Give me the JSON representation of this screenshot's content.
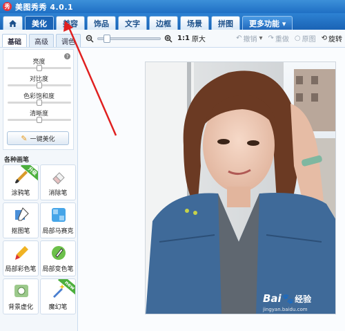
{
  "titlebar": {
    "logo_glyph": "秀",
    "title": "美图秀秀 4.0.1"
  },
  "tabs": [
    {
      "label": "美化",
      "active": true
    },
    {
      "label": "美容",
      "active": false
    },
    {
      "label": "饰品",
      "active": false
    },
    {
      "label": "文字",
      "active": false
    },
    {
      "label": "边框",
      "active": false
    },
    {
      "label": "场景",
      "active": false
    },
    {
      "label": "拼图",
      "active": false
    },
    {
      "label": "更多功能 ▾",
      "active": false
    }
  ],
  "home_icon": "home-icon",
  "subtabs": [
    {
      "label": "基础",
      "active": true
    },
    {
      "label": "高级",
      "active": false
    },
    {
      "label": "调色",
      "active": false
    }
  ],
  "zoom": {
    "ratio_label": "1:1",
    "original_label": "原大",
    "level": 0.1
  },
  "edit_tools": [
    {
      "icon": "↶",
      "label": "撤销",
      "has_dropdown": true,
      "enabled": false
    },
    {
      "icon": "↷",
      "label": "重做",
      "has_dropdown": false,
      "enabled": false
    },
    {
      "icon": "○",
      "label": "原图",
      "has_dropdown": false,
      "enabled": false
    },
    {
      "icon": "⟲",
      "label": "旋转",
      "has_dropdown": false,
      "enabled": true
    }
  ],
  "adjustments": [
    {
      "label": "亮度",
      "value": 0.5
    },
    {
      "label": "对比度",
      "value": 0.5
    },
    {
      "label": "色彩饱和度",
      "value": 0.5
    },
    {
      "label": "清晰度",
      "value": 0.5
    }
  ],
  "auto_beautify_label": "一键美化",
  "brush_section_title": "各种画笔",
  "brushes": [
    {
      "label": "涂鸦笔",
      "icon": "brush-icon",
      "ribbon": "升级"
    },
    {
      "label": "消除笔",
      "icon": "eraser-icon",
      "ribbon": ""
    },
    {
      "label": "抠图笔",
      "icon": "cutout-pen-icon",
      "ribbon": ""
    },
    {
      "label": "局部马赛克",
      "icon": "mosaic-icon",
      "ribbon": ""
    },
    {
      "label": "局部彩色笔",
      "icon": "color-pen-icon",
      "ribbon": ""
    },
    {
      "label": "局部变色笔",
      "icon": "recolor-pen-icon",
      "ribbon": ""
    },
    {
      "label": "背景虚化",
      "icon": "blur-background-icon",
      "ribbon": ""
    },
    {
      "label": "魔幻笔",
      "icon": "magic-wand-icon",
      "ribbon": "new"
    }
  ],
  "watermark": {
    "brand": "Bai",
    "brand_suffix": "经验",
    "url": "jingyan.baidu.com"
  },
  "colors": {
    "accent": "#1a63b5",
    "annotation": "#e02020"
  }
}
